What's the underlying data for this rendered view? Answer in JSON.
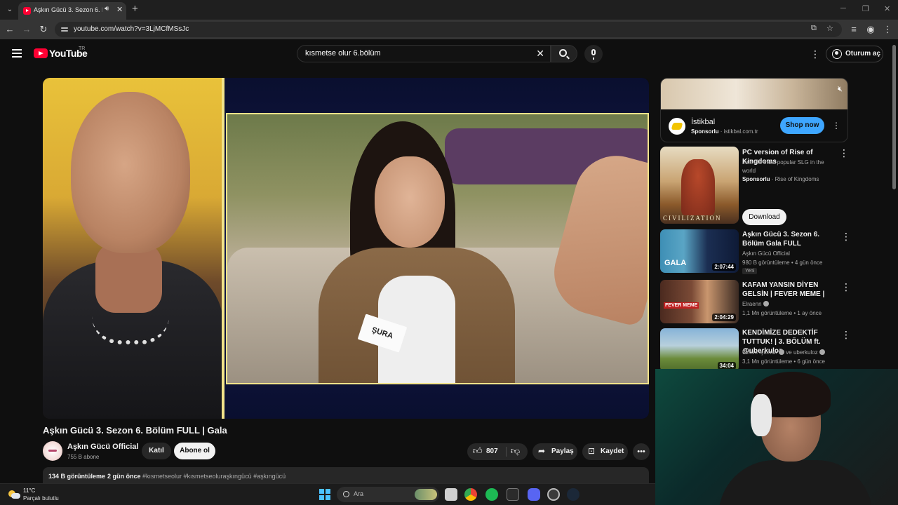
{
  "browser": {
    "tab_title": "Aşkın Gücü 3. Sezon 6. Bölüm",
    "tab_audio_icon": "speaker-icon",
    "url": "youtube.com/watch?v=3LjMCfMSsJc",
    "window_controls": [
      "─",
      "❐",
      "✕"
    ]
  },
  "youtube": {
    "logo_text": "YouTube",
    "region": "TR",
    "search_value": "kısmetse olur 6.bölüm",
    "signin_label": "Oturum aç"
  },
  "video": {
    "title": "Aşkın Gücü 3. Sezon 6. Bölüm FULL | Gala",
    "name_tag": "ŞURA",
    "channel_name": "Aşkın Gücü Official",
    "subscribers": "755 B abone",
    "join_label": "Katıl",
    "subscribe_label": "Abone ol",
    "likes": "807",
    "share_label": "Paylaş",
    "save_label": "Kaydet",
    "views": "134 B görüntüleme",
    "date": "2 gün önce",
    "tags": "#kısmetseolur #kısmetseoluraşkıngücü #aşkıngücü"
  },
  "sidebar": {
    "ad": {
      "name": "İstikbal",
      "sponsor_label": "Sponsorlu",
      "domain": "istikbal.com.tr",
      "cta": "Shop now"
    },
    "promo": {
      "title": "PC version of Rise of Kingdoms",
      "description": "Join the most popular SLG in the world",
      "sponsor_label": "Sponsorlu",
      "advertiser": "Rise of Kingdoms",
      "thumb_text": "CIVILIZATION",
      "cta": "Download"
    },
    "recommendations": [
      {
        "title": "Aşkın Gücü 3. Sezon 6. Bölüm Gala FULL",
        "channel": "Aşkın Gücü Official",
        "meta": "980 B görüntüleme • 4 gün önce",
        "badge": "Yeni",
        "duration": "2:07:44",
        "thumb_text": "GALA"
      },
      {
        "title": "KAFAM YANSIN DİYEN GELSİN | FEVER MEME |",
        "channel": "Elraenn",
        "meta": "1,1 Mn görüntüleme • 1 ay önce",
        "duration": "2:04:29",
        "thumb_text": "FEVER MEME"
      },
      {
        "title": "KENDİMİZE DEDEKTİF TUTTUK! | 3. BÖLÜM ft. @uberkuloz",
        "channel": "Orkun Işıtmak",
        "channel_extra": "ve uberkuloz",
        "meta": "3,1 Mn görüntüleme • 6 gün önce",
        "duration": "34:04"
      }
    ]
  },
  "taskbar": {
    "temperature": "11°C",
    "condition": "Parçalı bulutlu",
    "search_label": "Ara"
  },
  "colors": {
    "background": "#0f0f0f",
    "youtube_red": "#ff0033",
    "accent_blue": "#3ea6ff"
  }
}
